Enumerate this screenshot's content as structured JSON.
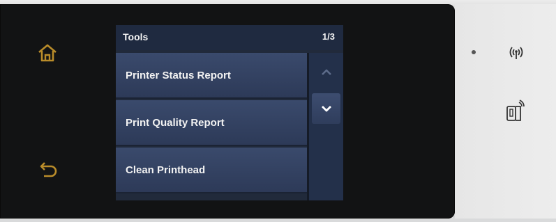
{
  "screen": {
    "title": "Tools",
    "page_indicator": "1/3"
  },
  "menu": {
    "items": [
      {
        "label": "Printer Status Report"
      },
      {
        "label": "Print Quality Report"
      },
      {
        "label": "Clean Printhead"
      }
    ]
  },
  "icons": {
    "home": "home-icon",
    "back": "back-icon",
    "scroll_up": "chevron-up-icon",
    "scroll_down": "chevron-down-icon",
    "wireless": "wireless-icon",
    "mobile_print": "mobile-print-icon"
  },
  "colors": {
    "accent": "#b98c2a",
    "screen_bg": "#212a3b",
    "item_bg": "#3a4a6c"
  }
}
